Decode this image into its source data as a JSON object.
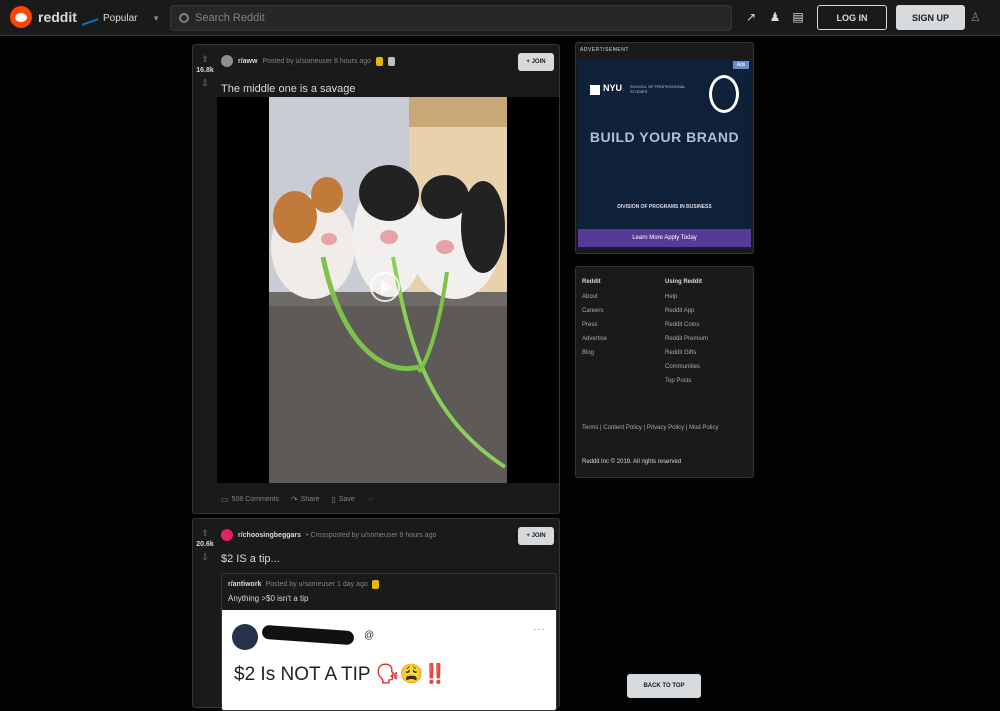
{
  "header": {
    "logo_text": "reddit",
    "feed_label": "Popular",
    "search_placeholder": "Search Reddit",
    "login_label": "LOG IN",
    "signup_label": "SIGN UP"
  },
  "posts": [
    {
      "score": "16.8k",
      "subreddit": "r/aww",
      "posted_by": "Posted by u/someuser 8 hours ago",
      "join_label": "+ JOIN",
      "title": "The middle one is a savage",
      "comments": "508 Comments",
      "share": "Share",
      "save": "Save",
      "more": "···"
    },
    {
      "score": "20.6k",
      "subreddit": "r/choosingbeggars",
      "posted_by": "• Crossposted by u/someuser 8 hours ago",
      "join_label": "+ JOIN",
      "title": "$2 IS a tip...",
      "crosspost": {
        "subreddit": "r/antiwork",
        "posted_by": "Posted by u/someuser 1 day ago",
        "text": "Anything >$0 isn't a tip"
      },
      "tweet": {
        "handle": "@",
        "text": "$2 Is NOT A TIP",
        "emoji": "🗣😩‼️",
        "more": "···"
      }
    }
  ],
  "advertisement": {
    "label": "ADVERTISEMENT",
    "corner": "Ads",
    "logo": "NYU",
    "logo_sub": "SCHOOL OF PROFESSIONAL STUDIES",
    "headline": "BUILD YOUR BRAND",
    "subline": "DIVISION OF PROGRAMS IN BUSINESS",
    "cta": "Learn More Apply Today"
  },
  "footer_links": {
    "col1_title": "Reddit",
    "col1": [
      "About",
      "Careers",
      "Press",
      "Advertise",
      "Blog"
    ],
    "col2_title": "Using Reddit",
    "col2": [
      "Help",
      "Reddit App",
      "Reddit Coins",
      "Reddit Premium",
      "Reddit Gifts",
      "Communities",
      "Top Posts"
    ],
    "legal": [
      "Terms",
      "Content Policy",
      "Privacy Policy",
      "Mod Policy"
    ],
    "copyright": "Reddit Inc © 2019. All rights reserved"
  },
  "back_to_top": "BACK TO TOP"
}
